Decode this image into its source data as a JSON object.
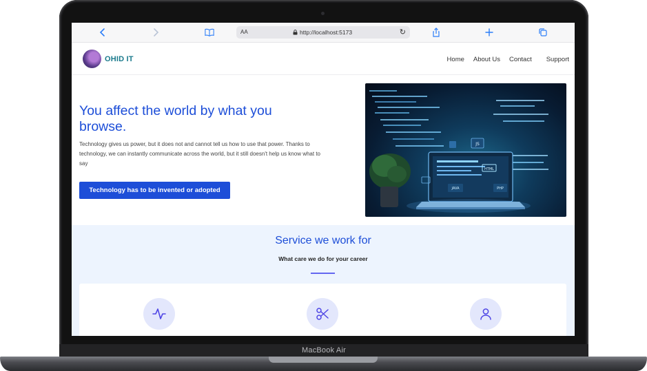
{
  "device": {
    "label": "MacBook Air"
  },
  "browser": {
    "text_size_label": "AA",
    "url": "http://localhost:5173",
    "icons": [
      "back-icon",
      "forward-icon",
      "bookmarks-icon",
      "lock-icon",
      "reload-icon",
      "share-icon",
      "new-tab-icon",
      "tabs-icon"
    ]
  },
  "site": {
    "brand": "OHID IT",
    "nav": [
      "Home",
      "About Us",
      "Contact",
      "Support"
    ]
  },
  "hero": {
    "title": "You affect the world by what you browse.",
    "description": "Technology gives us power, but it does not and cannot tell us how to use that power. Thanks to technology, we can instantly communicate across the world, but it still doesn't help us know what to say",
    "cta": "Technology has to be invented or adopted",
    "image_labels": [
      "JS",
      "HTML",
      "JAVA",
      "PHP"
    ]
  },
  "services": {
    "title": "Service we work for",
    "subtitle": "What care we do for your career",
    "icons": [
      "activity-icon",
      "scissors-icon",
      "user-icon"
    ]
  },
  "colors": {
    "primary": "#1d4ed8",
    "accent_line": "#6366f1",
    "services_bg": "#edf4fe",
    "icon_circle": "#e3e7fc",
    "brand_text": "#1a7a8c",
    "safari_blue": "#2c7ef8"
  }
}
